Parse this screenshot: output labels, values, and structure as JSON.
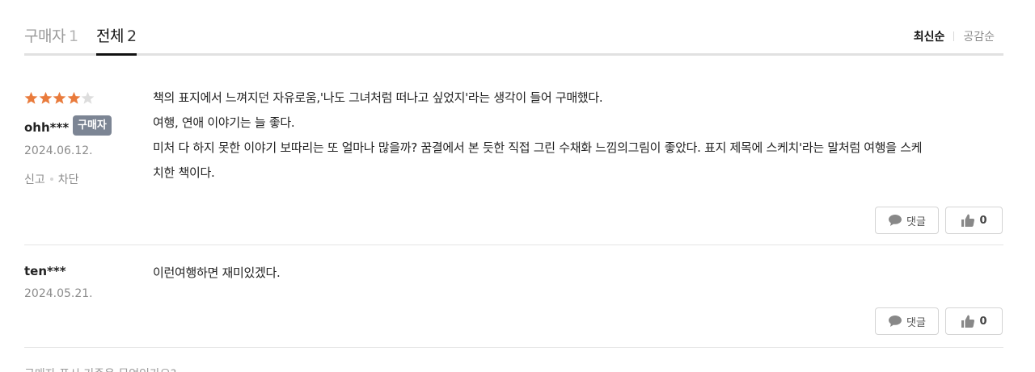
{
  "tabs": {
    "buyer": {
      "label": "구매자",
      "count": "1"
    },
    "all": {
      "label": "전체",
      "count": "2"
    }
  },
  "sort": {
    "latest": "최신순",
    "likes": "공감순"
  },
  "reviews": [
    {
      "rating": 4,
      "max_rating": 5,
      "user": "ohh***",
      "badge": "구매자",
      "date": "2024.06.12.",
      "report": "신고",
      "block": "차단",
      "lines": [
        "책의 표지에서 느껴지던 자유로움,'나도 그녀처럼 떠나고 싶었지'라는 생각이 들어 구매했다.",
        "여행, 연애 이야기는 늘 좋다.",
        "미처 다 하지 못한 이야기 보따리는 또 얼마나 많을까? 꿈결에서 본 듯한 직접 그린 수채화 느낌의그림이 좋았다. 표지 제목에 스케치'라는 말처럼 여행을 스케",
        "치한 책이다."
      ],
      "comment_label": "댓글",
      "likes": "0"
    },
    {
      "user": "ten***",
      "date": "2024.05.21.",
      "lines": [
        "이런여행하면 재미있겠다."
      ],
      "comment_label": "댓글",
      "likes": "0"
    }
  ],
  "footer_note": "구매자 표시 기준은 무엇인가요?",
  "colors": {
    "star_filled": "#e97b3c",
    "star_empty": "#dddddd",
    "badge_bg": "#7c8594"
  }
}
